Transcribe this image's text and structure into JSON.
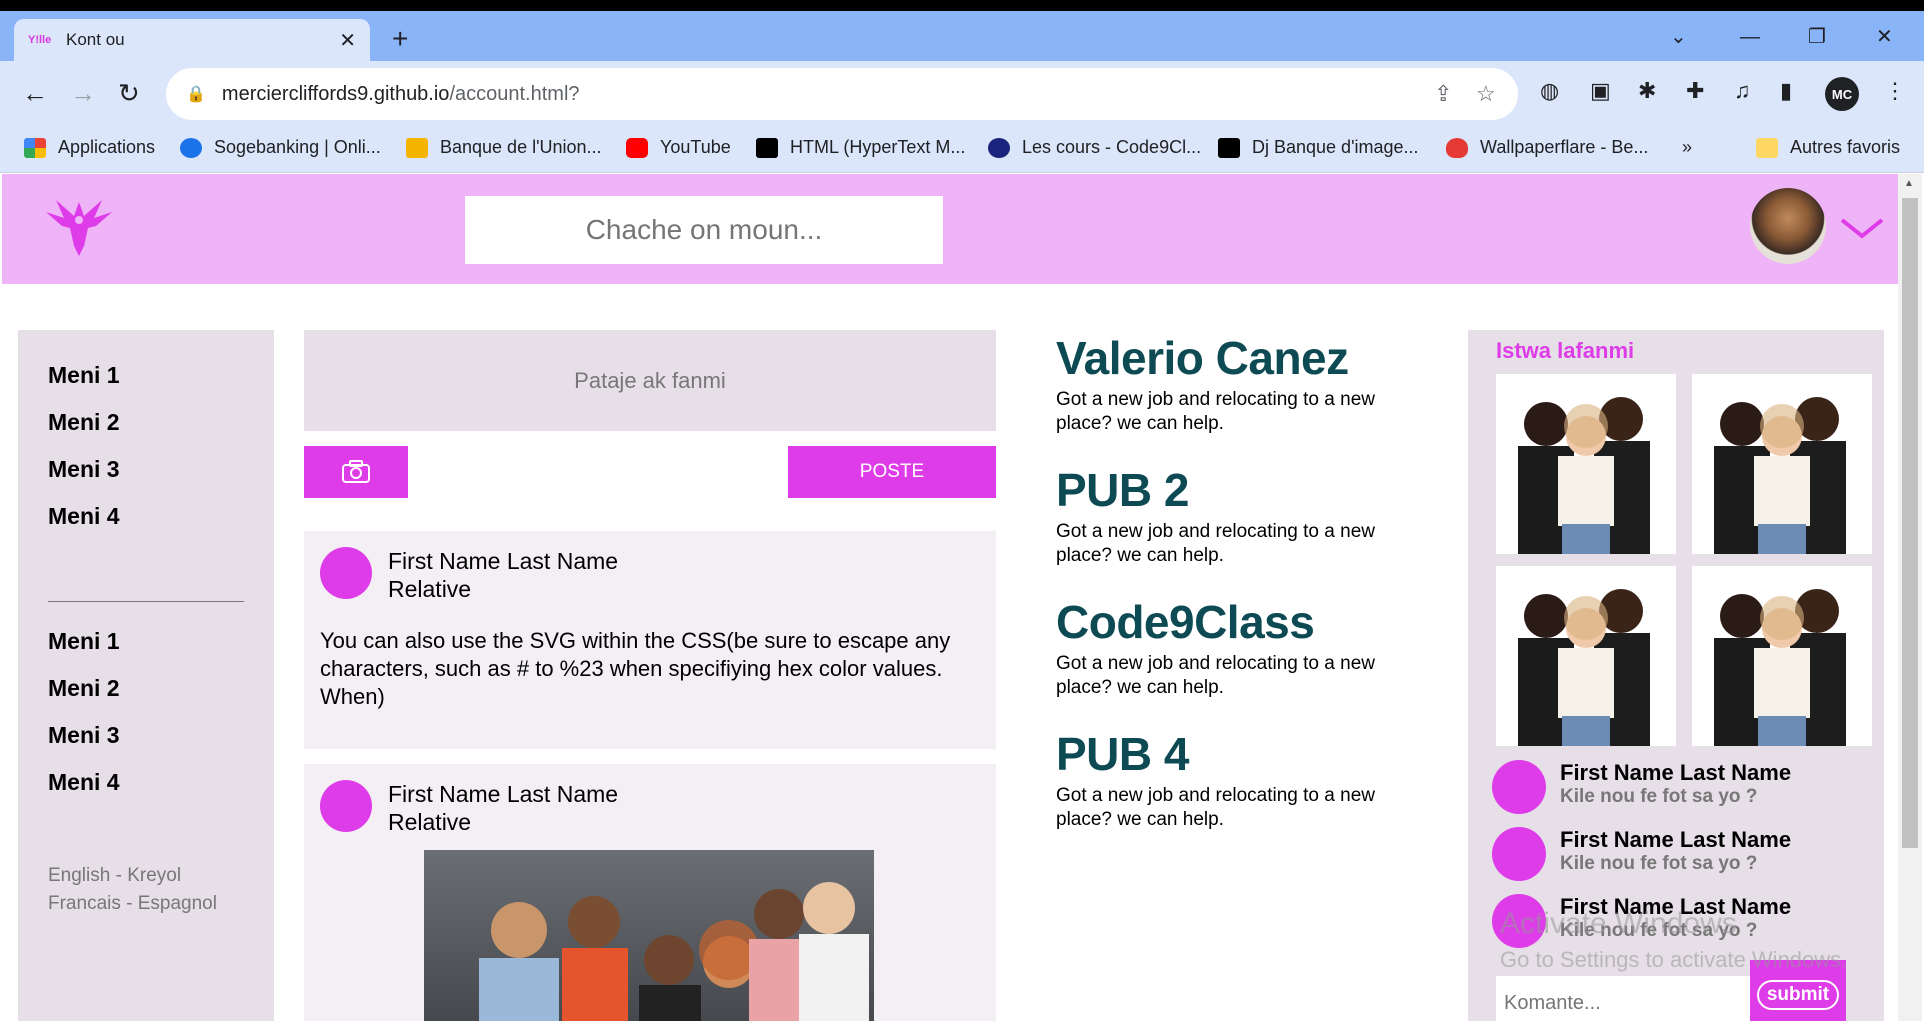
{
  "browser": {
    "tab_title": "Kont ou",
    "tab_favicon": "Y!lle",
    "url_host": "merciercliffords9.github.io",
    "url_path": "/account.html?",
    "profile_initials": "MC",
    "bookmarks": [
      {
        "label": "Applications",
        "icon": "apps-grid-icon",
        "color": "#4285f4"
      },
      {
        "label": "Sogebanking | Onli...",
        "icon": "sogebank-icon",
        "color": "#1a73e8"
      },
      {
        "label": "Banque de l'Union...",
        "icon": "bank-icon",
        "color": "#f4b400"
      },
      {
        "label": "YouTube",
        "icon": "youtube-icon",
        "color": "#ff0000"
      },
      {
        "label": "HTML (HyperText M...",
        "icon": "mdn-icon",
        "color": "#000000"
      },
      {
        "label": "Les cours - Code9Cl...",
        "icon": "code9class-icon",
        "color": "#1a237e"
      },
      {
        "label": "Dj Banque d'image...",
        "icon": "istock-icon",
        "color": "#000000"
      },
      {
        "label": "Wallpaperflare - Be...",
        "icon": "flame-icon",
        "color": "#e53935"
      }
    ],
    "other_bookmarks": "Autres favoris",
    "more_bookmarks": "»"
  },
  "header": {
    "search_placeholder": "Chache on moun...",
    "brand_color": "#de3ce8",
    "header_color": "#efb3f8"
  },
  "sidebar": {
    "menu_top": [
      "Meni 1",
      "Meni 2",
      "Meni 3",
      "Meni 4"
    ],
    "menu_bottom": [
      "Meni 1",
      "Meni 2",
      "Meni 3",
      "Meni 4"
    ],
    "languages_line1": "English - Kreyol",
    "languages_line2": "Francais - Espagnol"
  },
  "feed": {
    "compose_placeholder": "Pataje ak fanmi",
    "post_button": "POSTE",
    "posts": [
      {
        "name": "First Name Last Name",
        "relation": "Relative",
        "text": "You can also use the SVG within the CSS(be sure to escape any characters, such as # to %23 when specifiying hex color values. When)"
      },
      {
        "name": "First Name Last Name",
        "relation": "Relative"
      }
    ]
  },
  "ads": [
    {
      "title": "Valerio Canez",
      "body": "Got a new job and relocating to a new place? we can help."
    },
    {
      "title": "PUB 2",
      "body": "Got a new job and relocating to a new place? we can help."
    },
    {
      "title": "Code9Class",
      "body": "Got a new job and relocating to a new place? we can help."
    },
    {
      "title": "PUB 4",
      "body": "Got a new job and relocating to a new place? we can help."
    }
  ],
  "family": {
    "title": "Istwa lafanmi",
    "friends": [
      {
        "name": "First Name Last Name",
        "status": "Kile nou fe fot sa yo ?"
      },
      {
        "name": "First Name Last Name",
        "status": "Kile nou fe fot sa yo ?"
      },
      {
        "name": "First Name Last Name",
        "status": "Kile nou fe fot sa yo ?"
      }
    ],
    "comment_placeholder": "Komante...",
    "submit_label": "submit"
  },
  "watermark": {
    "line1": "Activate Windows",
    "line2": "Go to Settings to activate Windows."
  }
}
